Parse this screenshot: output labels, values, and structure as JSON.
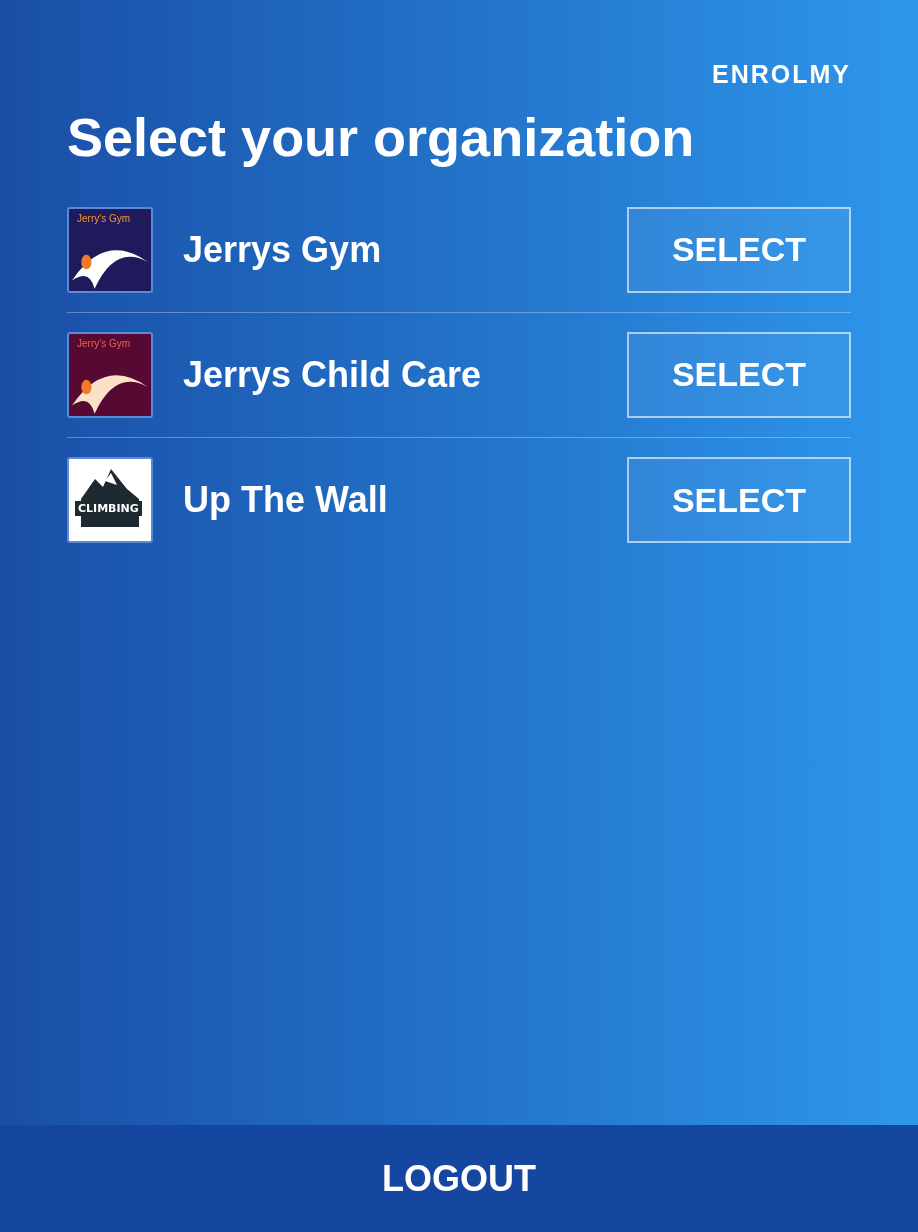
{
  "brand": "ENROLMY",
  "title": "Select your organization",
  "organizations": [
    {
      "name": "Jerrys Gym",
      "logo": {
        "kind": "gym",
        "text": "Jerry's Gym",
        "color": "#1f1a5c"
      },
      "button": "SELECT"
    },
    {
      "name": "Jerrys Child Care",
      "logo": {
        "kind": "gym",
        "text": "Jerry's Gym",
        "color": "#560a33"
      },
      "button": "SELECT"
    },
    {
      "name": "Up The Wall",
      "logo": {
        "kind": "climbing",
        "text": "CLIMBING",
        "color": "#ffffff"
      },
      "button": "SELECT"
    }
  ],
  "logout": "LOGOUT"
}
